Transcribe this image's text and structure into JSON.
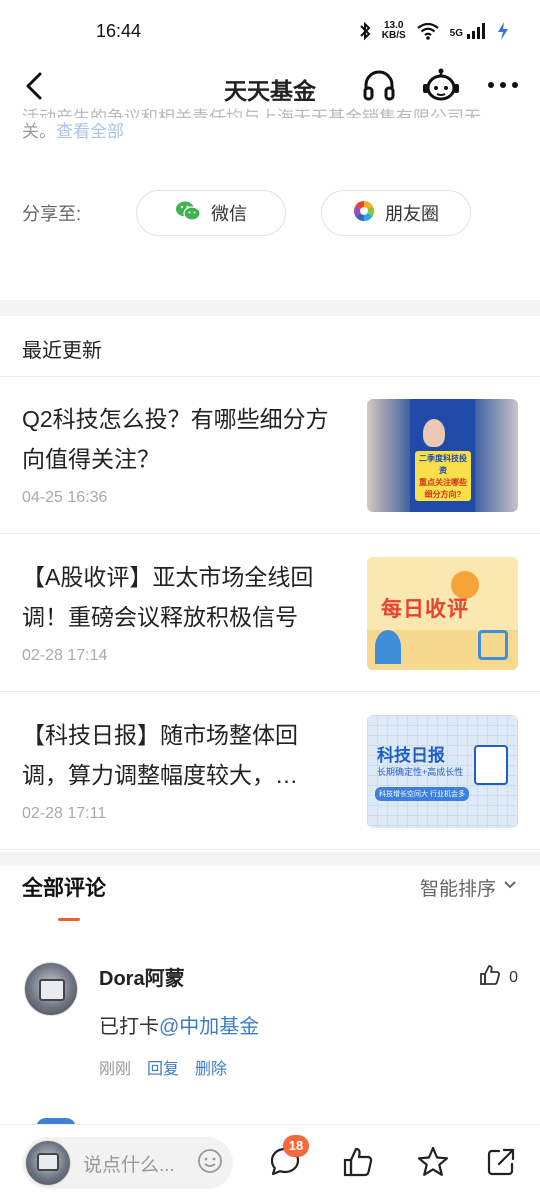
{
  "status_bar": {
    "time": "16:44",
    "net_speed_value": "13.0",
    "net_speed_unit": "KB/S",
    "network": "5G"
  },
  "nav": {
    "title": "天天基金"
  },
  "disclaimer": {
    "line1": "活动产生的争议和相关责任均与上海天天基金销售有限公司无",
    "line2": "关。",
    "link": "查看全部"
  },
  "share": {
    "label": "分享至:",
    "wechat": "微信",
    "moments": "朋友圈"
  },
  "recent": {
    "title": "最近更新",
    "items": [
      {
        "title": "Q2科技怎么投？有哪些细分方向值得关注？",
        "time": "04-25 16:36",
        "thumb_lines": [
          "二季度科技投资",
          "重点关注哪些",
          "细分方向?"
        ]
      },
      {
        "title": "【A股收评】亚太市场全线回调！重磅会议释放积极信号",
        "time": "02-28 17:14",
        "thumb_lines": [
          "每日收评"
        ]
      },
      {
        "title": "【科技日报】随市场整体回调，算力调整幅度较大，…",
        "time": "02-28 17:11",
        "thumb_lines": [
          "科技日报",
          "长期确定性+高成长性",
          "科技增长空间大 行业机会多"
        ]
      }
    ]
  },
  "comments": {
    "title": "全部评论",
    "sort": "智能排序",
    "items": [
      {
        "user": "Dora阿蒙",
        "likes": "0",
        "text_plain": "已打卡",
        "mention": "@中加基金",
        "time": "刚刚",
        "reply": "回复",
        "delete": "删除"
      }
    ]
  },
  "bottom_bar": {
    "placeholder": "说点什么...",
    "comment_count": "18"
  },
  "colors": {
    "accent": "#e8632b",
    "link": "#3c7cc8",
    "badge": "#f26a3d"
  }
}
